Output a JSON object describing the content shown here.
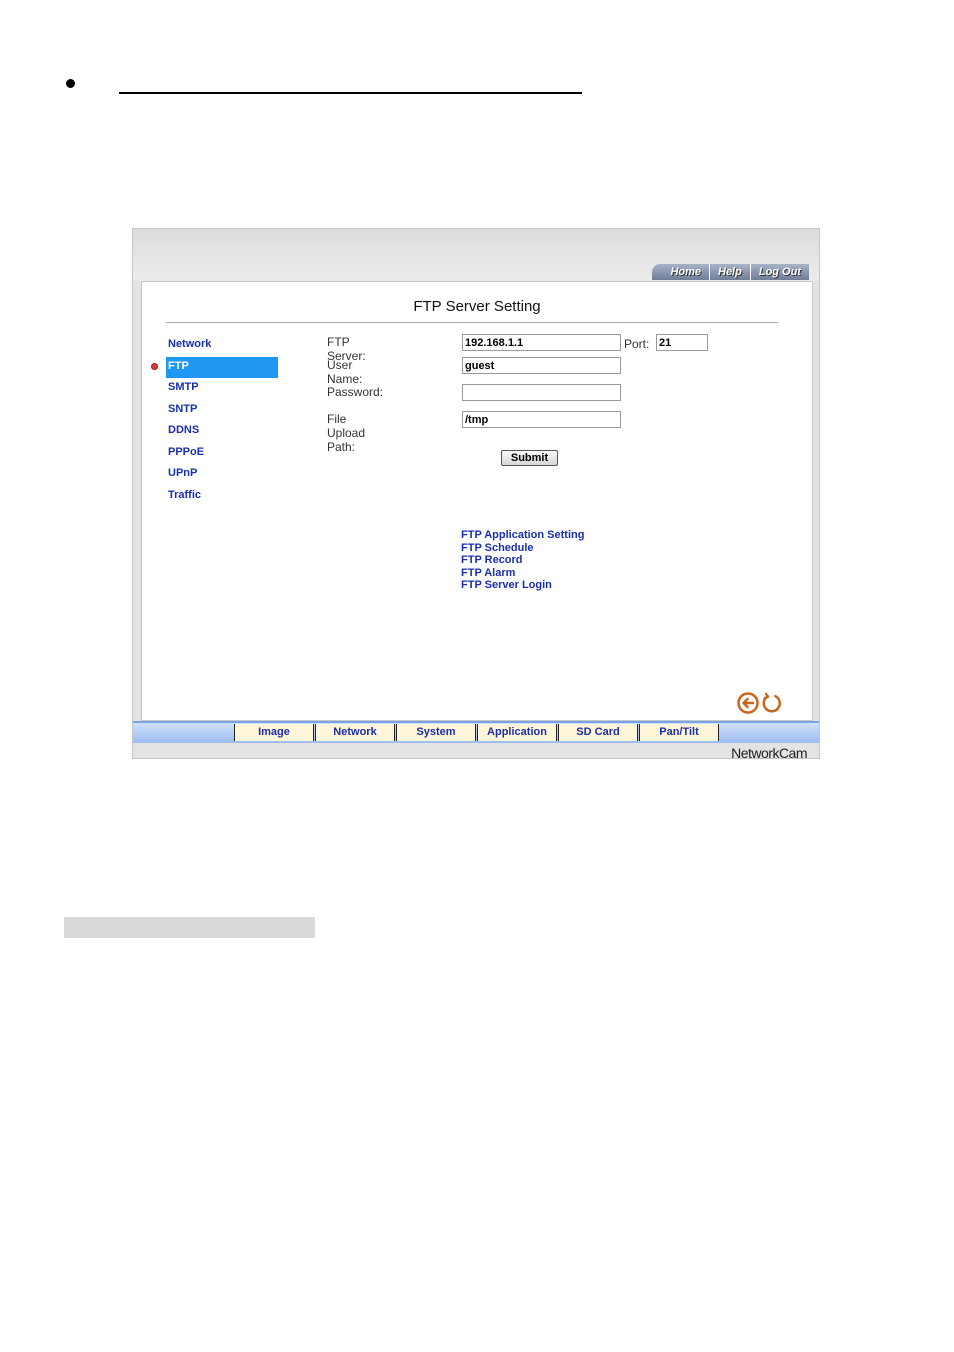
{
  "top_links": [
    "Home",
    "Help",
    "Log Out"
  ],
  "page_title": "FTP Server Setting",
  "sidebar": {
    "items": [
      "Network",
      "FTP",
      "SMTP",
      "SNTP",
      "DDNS",
      "PPPoE",
      "UPnP",
      "Traffic"
    ],
    "active": "FTP"
  },
  "form": {
    "ftp_server_label": "FTP Server:",
    "ftp_server_value": "192.168.1.1",
    "port_label": "Port:",
    "port_value": "21",
    "user_name_label": "User Name:",
    "user_name_value": "guest",
    "password_label": "Password:",
    "password_value": "",
    "upload_path_label": "File Upload Path:",
    "upload_path_value": "/tmp",
    "submit_label": "Submit"
  },
  "links": [
    "FTP Application Setting",
    "FTP Schedule",
    "FTP Record",
    "FTP Alarm",
    "FTP Server Login"
  ],
  "bottom_tabs": [
    "Image",
    "Network",
    "System",
    "Application",
    "SD Card",
    "Pan/Tilt"
  ],
  "brand": "NetworkCam",
  "colors": {
    "link": "#1b2fa8",
    "active_item": "#1e98f3",
    "icon_orange": "#c8671c"
  },
  "icons": [
    "back-arrow-icon",
    "refresh-icon",
    "active-dot-icon"
  ]
}
